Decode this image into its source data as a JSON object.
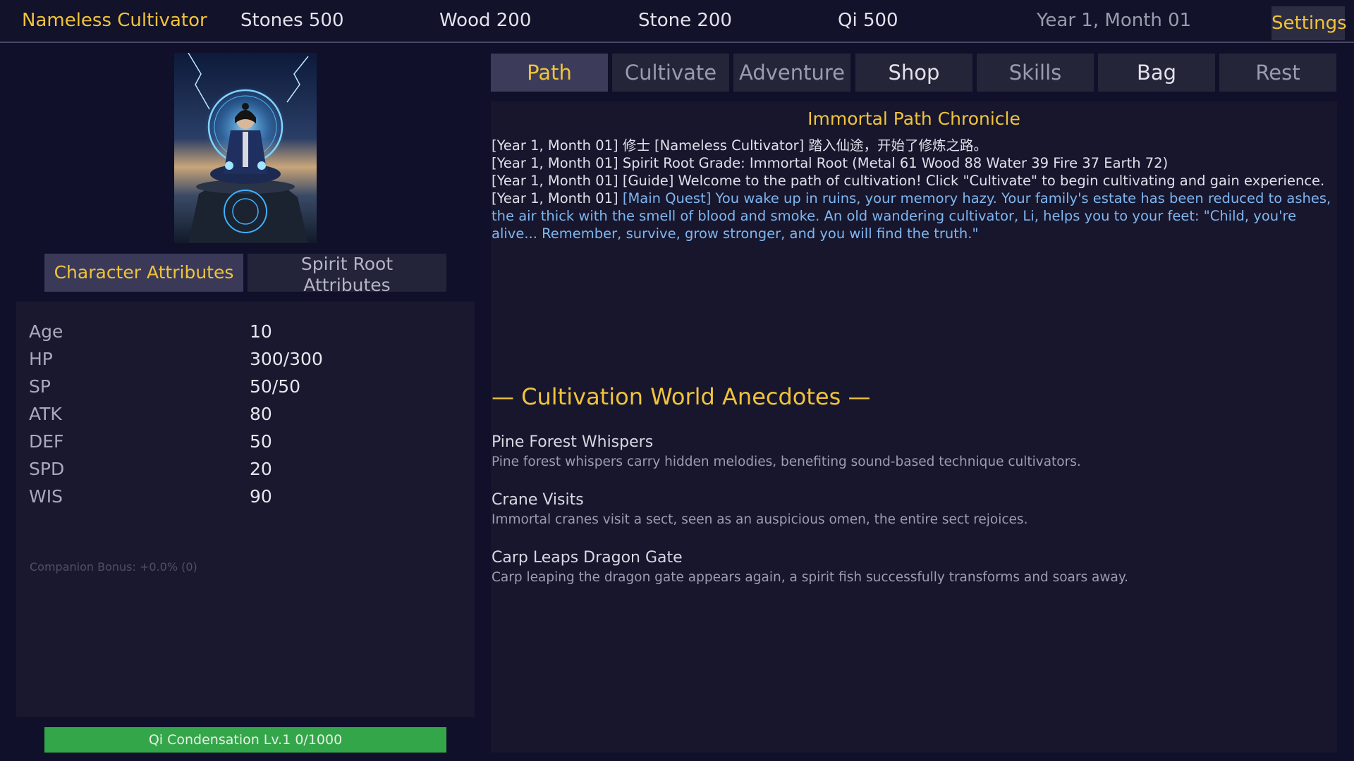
{
  "topbar": {
    "player_name": "Nameless Cultivator",
    "stones": "Stones 500",
    "wood": "Wood 200",
    "stone": "Stone 200",
    "qi": "Qi 500",
    "date": "Year 1, Month 01",
    "settings_label": "Settings"
  },
  "left": {
    "tabs": {
      "character_attributes": "Character Attributes",
      "spirit_root_attributes": "Spirit Root Attributes"
    },
    "attributes": [
      {
        "label": "Age",
        "value": "10"
      },
      {
        "label": "HP",
        "value": "300/300"
      },
      {
        "label": "SP",
        "value": "50/50"
      },
      {
        "label": "ATK",
        "value": "80"
      },
      {
        "label": "DEF",
        "value": "50"
      },
      {
        "label": "SPD",
        "value": "20"
      },
      {
        "label": "WIS",
        "value": "90"
      }
    ],
    "companion_bonus": "Companion Bonus: +0.0% (0)",
    "realm": {
      "label": "Qi Condensation Lv.1  0/1000",
      "progress": 1.0
    }
  },
  "nav": {
    "tabs": [
      "Path",
      "Cultivate",
      "Adventure",
      "Shop",
      "Skills",
      "Bag",
      "Rest"
    ],
    "active": "Path"
  },
  "chronicle": {
    "title": "Immortal Path Chronicle",
    "entries": [
      {
        "prefix": "[Year 1, Month 01]",
        "text": "修士 [Nameless Cultivator] 踏入仙途，开始了修炼之路。"
      },
      {
        "prefix": "[Year 1, Month 01]",
        "text": "Spirit Root Grade: Immortal Root (Metal 61 Wood 88 Water 39 Fire 37 Earth 72)"
      },
      {
        "prefix": "[Year 1, Month 01]",
        "text": "[Guide] Welcome to the path of cultivation! Click \"Cultivate\" to begin cultivating and gain experience."
      },
      {
        "prefix": "[Year 1, Month 01]",
        "text": "[Main Quest] You wake up in ruins, your memory hazy. Your family's estate has been reduced to ashes, the air thick with the smell of blood and smoke. An old wandering cultivator, Li, helps you to your feet: \"Child, you're alive... Remember, survive, grow stronger, and you will find the truth.\""
      }
    ]
  },
  "anecdotes": {
    "title": "— Cultivation World Anecdotes —",
    "items": [
      {
        "title": "Pine Forest Whispers",
        "desc": "Pine forest whispers carry hidden melodies, benefiting sound-based technique cultivators."
      },
      {
        "title": "Crane Visits",
        "desc": "Immortal cranes visit a sect, seen as an auspicious omen, the entire sect rejoices."
      },
      {
        "title": "Carp Leaps Dragon Gate",
        "desc": "Carp leaping the dragon gate appears again, a spirit fish successfully transforms and soars away."
      }
    ]
  },
  "colors": {
    "accent_gold": "#f0c33a",
    "quest_blue": "#7fb6f0",
    "progress_green": "#34a64a",
    "background": "#10102a"
  }
}
